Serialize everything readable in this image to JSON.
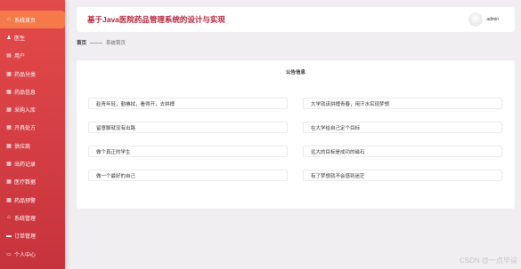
{
  "sidebar": {
    "items": [
      {
        "icon": "home-icon",
        "glyph": "⌂",
        "label": "系统首页",
        "active": true
      },
      {
        "icon": "user-icon",
        "glyph": "♟",
        "label": "医生"
      },
      {
        "icon": "clipboard-icon",
        "glyph": "▤",
        "label": "用户"
      },
      {
        "icon": "grid-icon",
        "glyph": "▦",
        "label": "药品分类"
      },
      {
        "icon": "grid-icon",
        "glyph": "▦",
        "label": "药品信息"
      },
      {
        "icon": "grid-icon",
        "glyph": "▦",
        "label": "采购入库"
      },
      {
        "icon": "grid-icon",
        "glyph": "▦",
        "label": "开具处方"
      },
      {
        "icon": "grid-icon",
        "glyph": "▦",
        "label": "供应商"
      },
      {
        "icon": "grid-icon",
        "glyph": "▦",
        "label": "出药记录"
      },
      {
        "icon": "grid-icon",
        "glyph": "▦",
        "label": "医疗数据"
      },
      {
        "icon": "grid-icon",
        "glyph": "▦",
        "label": "药品预警"
      },
      {
        "icon": "bank-icon",
        "glyph": "⌂",
        "label": "系统管理"
      },
      {
        "icon": "cart-icon",
        "glyph": "▬",
        "label": "订单管理"
      },
      {
        "icon": "profile-icon",
        "glyph": "▭",
        "label": "个人中心"
      }
    ]
  },
  "header": {
    "title": "基于Java医院药品管理系统的设计与实现",
    "username": "admin"
  },
  "breadcrumb": {
    "home": "首页",
    "current": "系统首页"
  },
  "notice_board": {
    "title": "公告信息",
    "items": [
      "趁青年轻，勤拂拭，看得开，去拼搏",
      "大学就该拼搏青春，用汗水实现梦想",
      "留意脚就没有出路",
      "在大学给自己定个目标",
      "做个真正的学生",
      "远大的目标是成功的磁石",
      "做一个最好的自己",
      "有了梦想就不会感到迷茫"
    ]
  },
  "watermark": "CSDN @一点毕设"
}
